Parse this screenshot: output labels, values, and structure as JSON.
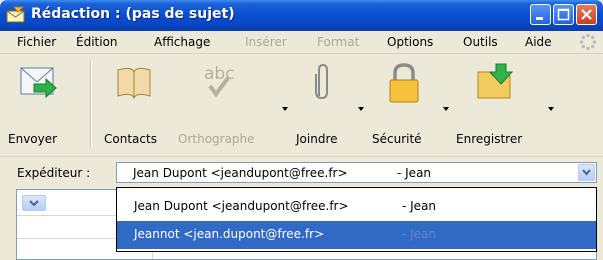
{
  "window": {
    "title": "Rédaction : (pas de sujet)"
  },
  "menu": {
    "items": [
      {
        "label": "Fichier",
        "enabled": true
      },
      {
        "label": "Édition",
        "enabled": true
      },
      {
        "label": "Affichage",
        "enabled": true
      },
      {
        "label": "Insérer",
        "enabled": false
      },
      {
        "label": "Format",
        "enabled": false
      },
      {
        "label": "Options",
        "enabled": true
      },
      {
        "label": "Outils",
        "enabled": true
      },
      {
        "label": "Aide",
        "enabled": true
      }
    ]
  },
  "toolbar": {
    "buttons": [
      {
        "label": "Envoyer",
        "icon": "send-icon",
        "enabled": true
      },
      {
        "label": "Contacts",
        "icon": "address-book-icon",
        "enabled": true
      },
      {
        "label": "Orthographe",
        "icon": "spellcheck-icon",
        "enabled": false
      },
      {
        "label": "Joindre",
        "icon": "paperclip-icon",
        "enabled": true
      },
      {
        "label": "Sécurité",
        "icon": "padlock-icon",
        "enabled": true
      },
      {
        "label": "Enregistrer",
        "icon": "save-folder-icon",
        "enabled": true
      }
    ]
  },
  "sender": {
    "label": "Expéditeur :",
    "value": "Jean Dupont <jeandupont@free.fr>",
    "alias": "- Jean"
  },
  "sender_dropdown": {
    "options": [
      {
        "value": "Jean Dupont <jeandupont@free.fr>",
        "alias": "- Jean",
        "selected": false
      },
      {
        "value": "Jeannot <jean.dupont@free.fr>",
        "alias": "- Jean",
        "selected": true
      }
    ]
  },
  "colors": {
    "titlebar": "#0a4fd1",
    "selection": "#316ac5",
    "chrome": "#ece9d8",
    "close_button": "#c8401f"
  }
}
